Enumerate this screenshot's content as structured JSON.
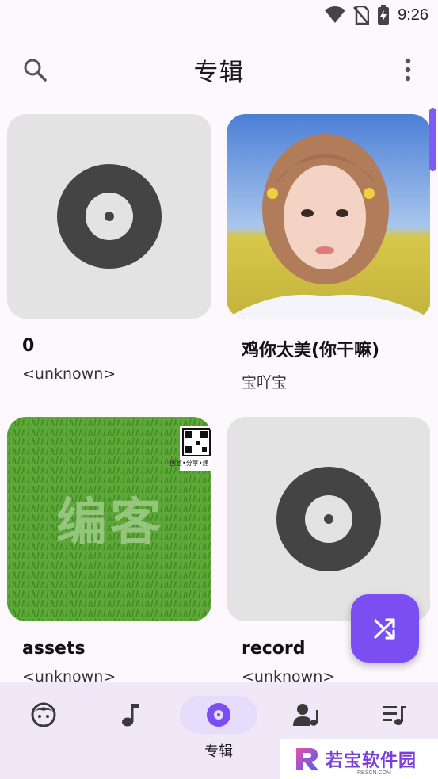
{
  "status_bar": {
    "time": "9:26",
    "icons": [
      "wifi-icon",
      "no-sim-icon",
      "battery-charging-icon"
    ]
  },
  "app_bar": {
    "title": "专辑",
    "search_icon": "search-icon",
    "more_icon": "more-vert-icon"
  },
  "albums": [
    {
      "title": "0",
      "artist": "<unknown>",
      "cover": "placeholder-disc"
    },
    {
      "title": "鸡你太美(你干嘛)",
      "artist": "宝吖宝",
      "cover": "portrait-photo"
    },
    {
      "title": "assets",
      "artist": "<unknown>",
      "cover": "grass-image",
      "cover_text": "编客",
      "qr_caption": "创意•分享•建"
    },
    {
      "title": "record",
      "artist": "<unknown>",
      "cover": "placeholder-disc"
    }
  ],
  "fab": {
    "icon": "shuffle-icon"
  },
  "bottom_nav": {
    "items": [
      {
        "icon": "face-icon",
        "label": ""
      },
      {
        "icon": "music-note-icon",
        "label": ""
      },
      {
        "icon": "album-icon",
        "label": "专辑",
        "active": true
      },
      {
        "icon": "artist-icon",
        "label": ""
      },
      {
        "icon": "playlist-icon",
        "label": ""
      }
    ]
  },
  "watermark": {
    "text": "若宝软件园",
    "sub": "RBSCN.COM"
  },
  "colors": {
    "accent": "#7b4ef2",
    "nav_background": "#f0e8f6",
    "active_pill": "#e6dcfb",
    "page_background": "#fdf7fe"
  }
}
